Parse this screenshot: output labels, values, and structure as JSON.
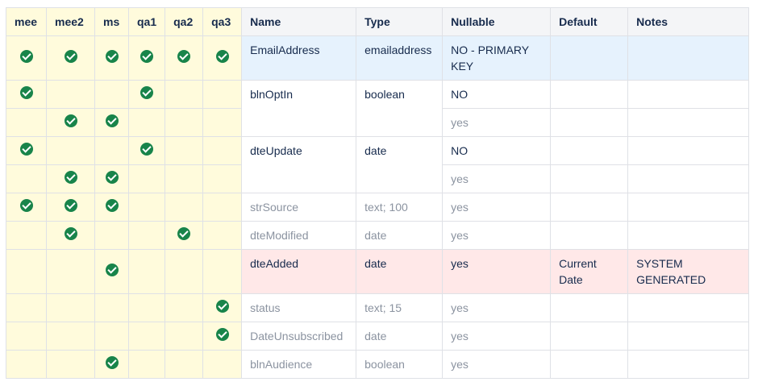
{
  "headers": {
    "env": [
      "mee",
      "mee2",
      "ms",
      "qa1",
      "qa2",
      "qa3"
    ],
    "data": [
      "Name",
      "Type",
      "Nullable",
      "Default",
      "Notes"
    ]
  },
  "icon": "check-circle-icon",
  "rows": [
    {
      "env": [
        true,
        true,
        true,
        true,
        true,
        true
      ],
      "name": "EmailAddress",
      "type": "emailaddress",
      "nullable": "NO - PRIMARY KEY"
    },
    {
      "env": [
        true,
        false,
        false,
        true,
        false,
        false
      ],
      "name": "blnOptIn",
      "type": "boolean",
      "nullable": "NO"
    },
    {
      "env": [
        false,
        true,
        true,
        false,
        false,
        false
      ],
      "nullable": "yes"
    },
    {
      "env": [
        true,
        false,
        false,
        true,
        false,
        false
      ],
      "name": "dteUpdate",
      "type": "date",
      "nullable": "NO"
    },
    {
      "env": [
        false,
        true,
        true,
        false,
        false,
        false
      ],
      "nullable": "yes"
    },
    {
      "env": [
        true,
        true,
        true,
        false,
        false,
        false
      ],
      "name": "strSource",
      "type": "text; 100",
      "nullable": "yes"
    },
    {
      "env": [
        false,
        true,
        false,
        false,
        true,
        false
      ],
      "name": "dteModified",
      "type": "date",
      "nullable": "yes"
    },
    {
      "env": [
        false,
        false,
        true,
        false,
        false,
        false
      ],
      "name": "dteAdded",
      "type": "date",
      "nullable": "yes",
      "default": "Current Date",
      "notes": "SYSTEM GENERATED"
    },
    {
      "env": [
        false,
        false,
        false,
        false,
        false,
        true
      ],
      "name": "status",
      "type": "text; 15",
      "nullable": "yes"
    },
    {
      "env": [
        false,
        false,
        false,
        false,
        false,
        true
      ],
      "name": "DateUnsubscribed",
      "type": "date",
      "nullable": "yes"
    },
    {
      "env": [
        false,
        false,
        true,
        false,
        false,
        false
      ],
      "name": "blnAudience",
      "type": "boolean",
      "nullable": "yes"
    }
  ]
}
